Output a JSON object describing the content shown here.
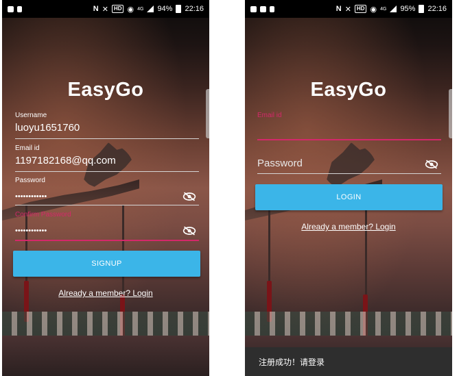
{
  "left_screen": {
    "status": {
      "battery": "94%",
      "time": "22:16",
      "hd": "HD",
      "net": "4G"
    },
    "title": "EasyGo",
    "username": {
      "label": "Username",
      "value": "luoyu1651760"
    },
    "email": {
      "label": "Email id",
      "value": "1197182168@qq.com"
    },
    "password": {
      "label": "Password",
      "value": "••••••••••••"
    },
    "confirm_password": {
      "label": "Confirm Password",
      "value": "••••••••••••"
    },
    "signup_button": "SIGNUP",
    "login_link": "Already a member? Login"
  },
  "right_screen": {
    "status": {
      "battery": "95%",
      "time": "22:16",
      "hd": "HD",
      "net": "4G"
    },
    "title": "EasyGo",
    "email": {
      "label": "Email id",
      "value": ""
    },
    "password": {
      "placeholder": "Password"
    },
    "login_button": "LOGIN",
    "login_link": "Already a member? Login",
    "toast": "注册成功！请登录"
  },
  "colors": {
    "accent": "#3bb5e8",
    "focus": "#d4286a"
  },
  "icons": [
    "visibility-off-icon",
    "signal-icon",
    "battery-icon",
    "nfc-icon",
    "wifi-icon"
  ]
}
